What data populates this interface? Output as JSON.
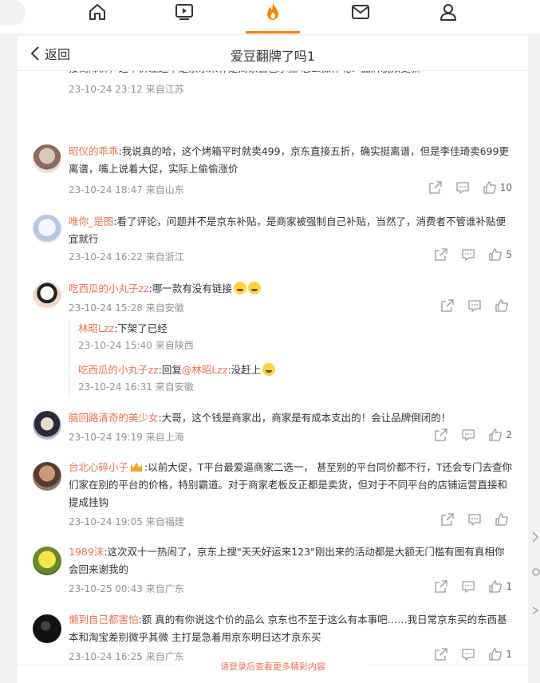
{
  "top_nav": {
    "items": [
      {
        "name": "home",
        "icon": "home-icon"
      },
      {
        "name": "video",
        "icon": "video-icon"
      },
      {
        "name": "hot",
        "icon": "fire-icon",
        "active": true
      },
      {
        "name": "messages",
        "icon": "mail-icon"
      },
      {
        "name": "profile",
        "icon": "user-icon"
      }
    ],
    "accent": "#ff8200"
  },
  "header": {
    "back_label": "返回",
    "title": "爱豆翻牌了吗1"
  },
  "comments": [
    {
      "text_fragment": "接商降价，这个价差还不是京东来补是商家自己承担 怎么操作呢？品牌貌双更新",
      "time": "23-10-24 23:12",
      "location": "来自江苏"
    },
    {
      "user": "昭仪的乖乖",
      "text": ":我说真的哈，这个烤箱平时就卖499，京东直接五折，确实挺离谱，但是李佳琦卖699更离谱，嘴上说着大促，实际上偷偷涨价",
      "time": "23-10-24 18:47",
      "location": "来自山东",
      "likes": "10"
    },
    {
      "user": "唯你_是图",
      "text": ":看了评论，问题并不是京东补贴，是商家被强制自己补贴，当然了，消费者不管谁补贴便宜就行",
      "time": "23-10-24 16:22",
      "location": "来自浙江",
      "likes": "5"
    },
    {
      "user": "吃西瓜的小丸子zz",
      "text": ":哪一款有没有链接",
      "time": "23-10-24 15:28",
      "location": "来自安徽",
      "likes": "",
      "replies": [
        {
          "user": "林昭Lzz",
          "text": ":下架了已经",
          "time": "23-10-24 15:40",
          "location": "来自陕西"
        },
        {
          "user": "吃西瓜的小丸子zz",
          "text_prefix": ":回复",
          "mention": "@林昭Lzz",
          "text": ":没赶上",
          "time": "23-10-24 16:31",
          "location": "来自安徽"
        }
      ]
    },
    {
      "user": "脑回路清奇的美少女",
      "text": ":大哥，这个钱是商家出，商家是有成本支出的！会让品牌倒闭的！",
      "time": "23-10-24 19:19",
      "location": "来自上海",
      "likes": "2"
    },
    {
      "user": "台北心碎小子",
      "text": ":以前大促，T平台最爱逼商家二选一， 甚至别的平台同价都不行，T还会专门去查你们家在别的平台的价格，特别霸道。对于商家老板反正都是卖货，但对于不同平台的店铺运营直接和提成挂钩",
      "time": "23-10-24 19:05",
      "location": "来自福建",
      "likes": ""
    },
    {
      "user": "1989沫",
      "text": ":这次双十一热闹了，京东上搜\"天天好运来123\"刚出来的活动都是大额无门槛有图有真相你会回来谢我的",
      "time": "23-10-25 00:43",
      "location": "来自广东",
      "likes": "1"
    },
    {
      "user": "懒到自己都害怕",
      "text": ":额 真的有你说这个价的品么  京东也不至于这么有本事吧……我日常京东买的东西基本和淘宝差别微乎其微  主打是急着用京东明日达才京东买",
      "time": "23-10-24 16:25",
      "location": "来自广东",
      "likes": "1"
    }
  ],
  "footer": {
    "login_prompt": "请登录后查看更多精彩内容"
  }
}
